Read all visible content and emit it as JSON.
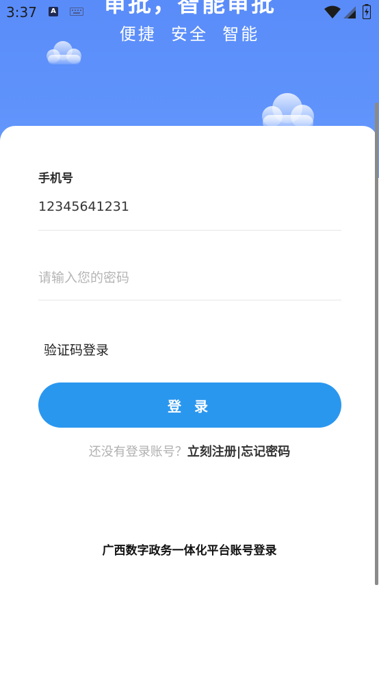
{
  "status_bar": {
    "time": "3:37",
    "a_badge": "A"
  },
  "hero": {
    "title": "审批，智能审批",
    "subtitle": "便捷  安全  智能"
  },
  "form": {
    "phone_label": "手机号",
    "phone_value": "12345641231",
    "password_placeholder": "请输入您的密码",
    "sms_login": "验证码登录",
    "login_button": "登 录",
    "register_prompt": "还没有登录账号？",
    "register_link": "立刻注册",
    "separator": "|",
    "forgot_link": "忘记密码"
  },
  "footer": {
    "gx_login": "广西数字政务一体化平台账号登录"
  },
  "colors": {
    "hero_blue": "#5f93fb",
    "button_blue": "#2a97ef"
  }
}
